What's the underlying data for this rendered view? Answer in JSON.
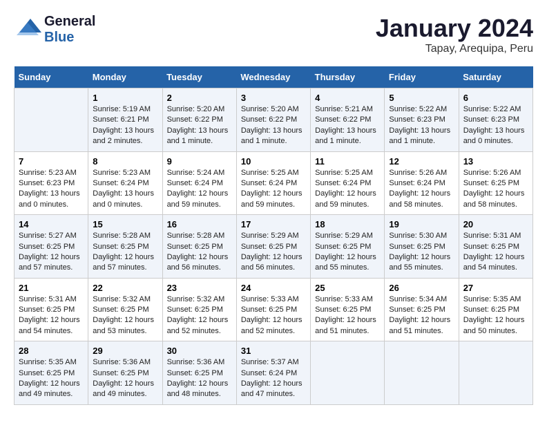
{
  "header": {
    "logo_line1": "General",
    "logo_line2": "Blue",
    "title": "January 2024",
    "subtitle": "Tapay, Arequipa, Peru"
  },
  "days_of_week": [
    "Sunday",
    "Monday",
    "Tuesday",
    "Wednesday",
    "Thursday",
    "Friday",
    "Saturday"
  ],
  "weeks": [
    [
      {
        "day": "",
        "info": ""
      },
      {
        "day": "1",
        "info": "Sunrise: 5:19 AM\nSunset: 6:21 PM\nDaylight: 13 hours\nand 2 minutes."
      },
      {
        "day": "2",
        "info": "Sunrise: 5:20 AM\nSunset: 6:22 PM\nDaylight: 13 hours\nand 1 minute."
      },
      {
        "day": "3",
        "info": "Sunrise: 5:20 AM\nSunset: 6:22 PM\nDaylight: 13 hours\nand 1 minute."
      },
      {
        "day": "4",
        "info": "Sunrise: 5:21 AM\nSunset: 6:22 PM\nDaylight: 13 hours\nand 1 minute."
      },
      {
        "day": "5",
        "info": "Sunrise: 5:22 AM\nSunset: 6:23 PM\nDaylight: 13 hours\nand 1 minute."
      },
      {
        "day": "6",
        "info": "Sunrise: 5:22 AM\nSunset: 6:23 PM\nDaylight: 13 hours\nand 0 minutes."
      }
    ],
    [
      {
        "day": "7",
        "info": "Sunrise: 5:23 AM\nSunset: 6:23 PM\nDaylight: 13 hours\nand 0 minutes."
      },
      {
        "day": "8",
        "info": "Sunrise: 5:23 AM\nSunset: 6:24 PM\nDaylight: 13 hours\nand 0 minutes."
      },
      {
        "day": "9",
        "info": "Sunrise: 5:24 AM\nSunset: 6:24 PM\nDaylight: 12 hours\nand 59 minutes."
      },
      {
        "day": "10",
        "info": "Sunrise: 5:25 AM\nSunset: 6:24 PM\nDaylight: 12 hours\nand 59 minutes."
      },
      {
        "day": "11",
        "info": "Sunrise: 5:25 AM\nSunset: 6:24 PM\nDaylight: 12 hours\nand 59 minutes."
      },
      {
        "day": "12",
        "info": "Sunrise: 5:26 AM\nSunset: 6:24 PM\nDaylight: 12 hours\nand 58 minutes."
      },
      {
        "day": "13",
        "info": "Sunrise: 5:26 AM\nSunset: 6:25 PM\nDaylight: 12 hours\nand 58 minutes."
      }
    ],
    [
      {
        "day": "14",
        "info": "Sunrise: 5:27 AM\nSunset: 6:25 PM\nDaylight: 12 hours\nand 57 minutes."
      },
      {
        "day": "15",
        "info": "Sunrise: 5:28 AM\nSunset: 6:25 PM\nDaylight: 12 hours\nand 57 minutes."
      },
      {
        "day": "16",
        "info": "Sunrise: 5:28 AM\nSunset: 6:25 PM\nDaylight: 12 hours\nand 56 minutes."
      },
      {
        "day": "17",
        "info": "Sunrise: 5:29 AM\nSunset: 6:25 PM\nDaylight: 12 hours\nand 56 minutes."
      },
      {
        "day": "18",
        "info": "Sunrise: 5:29 AM\nSunset: 6:25 PM\nDaylight: 12 hours\nand 55 minutes."
      },
      {
        "day": "19",
        "info": "Sunrise: 5:30 AM\nSunset: 6:25 PM\nDaylight: 12 hours\nand 55 minutes."
      },
      {
        "day": "20",
        "info": "Sunrise: 5:31 AM\nSunset: 6:25 PM\nDaylight: 12 hours\nand 54 minutes."
      }
    ],
    [
      {
        "day": "21",
        "info": "Sunrise: 5:31 AM\nSunset: 6:25 PM\nDaylight: 12 hours\nand 54 minutes."
      },
      {
        "day": "22",
        "info": "Sunrise: 5:32 AM\nSunset: 6:25 PM\nDaylight: 12 hours\nand 53 minutes."
      },
      {
        "day": "23",
        "info": "Sunrise: 5:32 AM\nSunset: 6:25 PM\nDaylight: 12 hours\nand 52 minutes."
      },
      {
        "day": "24",
        "info": "Sunrise: 5:33 AM\nSunset: 6:25 PM\nDaylight: 12 hours\nand 52 minutes."
      },
      {
        "day": "25",
        "info": "Sunrise: 5:33 AM\nSunset: 6:25 PM\nDaylight: 12 hours\nand 51 minutes."
      },
      {
        "day": "26",
        "info": "Sunrise: 5:34 AM\nSunset: 6:25 PM\nDaylight: 12 hours\nand 51 minutes."
      },
      {
        "day": "27",
        "info": "Sunrise: 5:35 AM\nSunset: 6:25 PM\nDaylight: 12 hours\nand 50 minutes."
      }
    ],
    [
      {
        "day": "28",
        "info": "Sunrise: 5:35 AM\nSunset: 6:25 PM\nDaylight: 12 hours\nand 49 minutes."
      },
      {
        "day": "29",
        "info": "Sunrise: 5:36 AM\nSunset: 6:25 PM\nDaylight: 12 hours\nand 49 minutes."
      },
      {
        "day": "30",
        "info": "Sunrise: 5:36 AM\nSunset: 6:25 PM\nDaylight: 12 hours\nand 48 minutes."
      },
      {
        "day": "31",
        "info": "Sunrise: 5:37 AM\nSunset: 6:24 PM\nDaylight: 12 hours\nand 47 minutes."
      },
      {
        "day": "",
        "info": ""
      },
      {
        "day": "",
        "info": ""
      },
      {
        "day": "",
        "info": ""
      }
    ]
  ]
}
